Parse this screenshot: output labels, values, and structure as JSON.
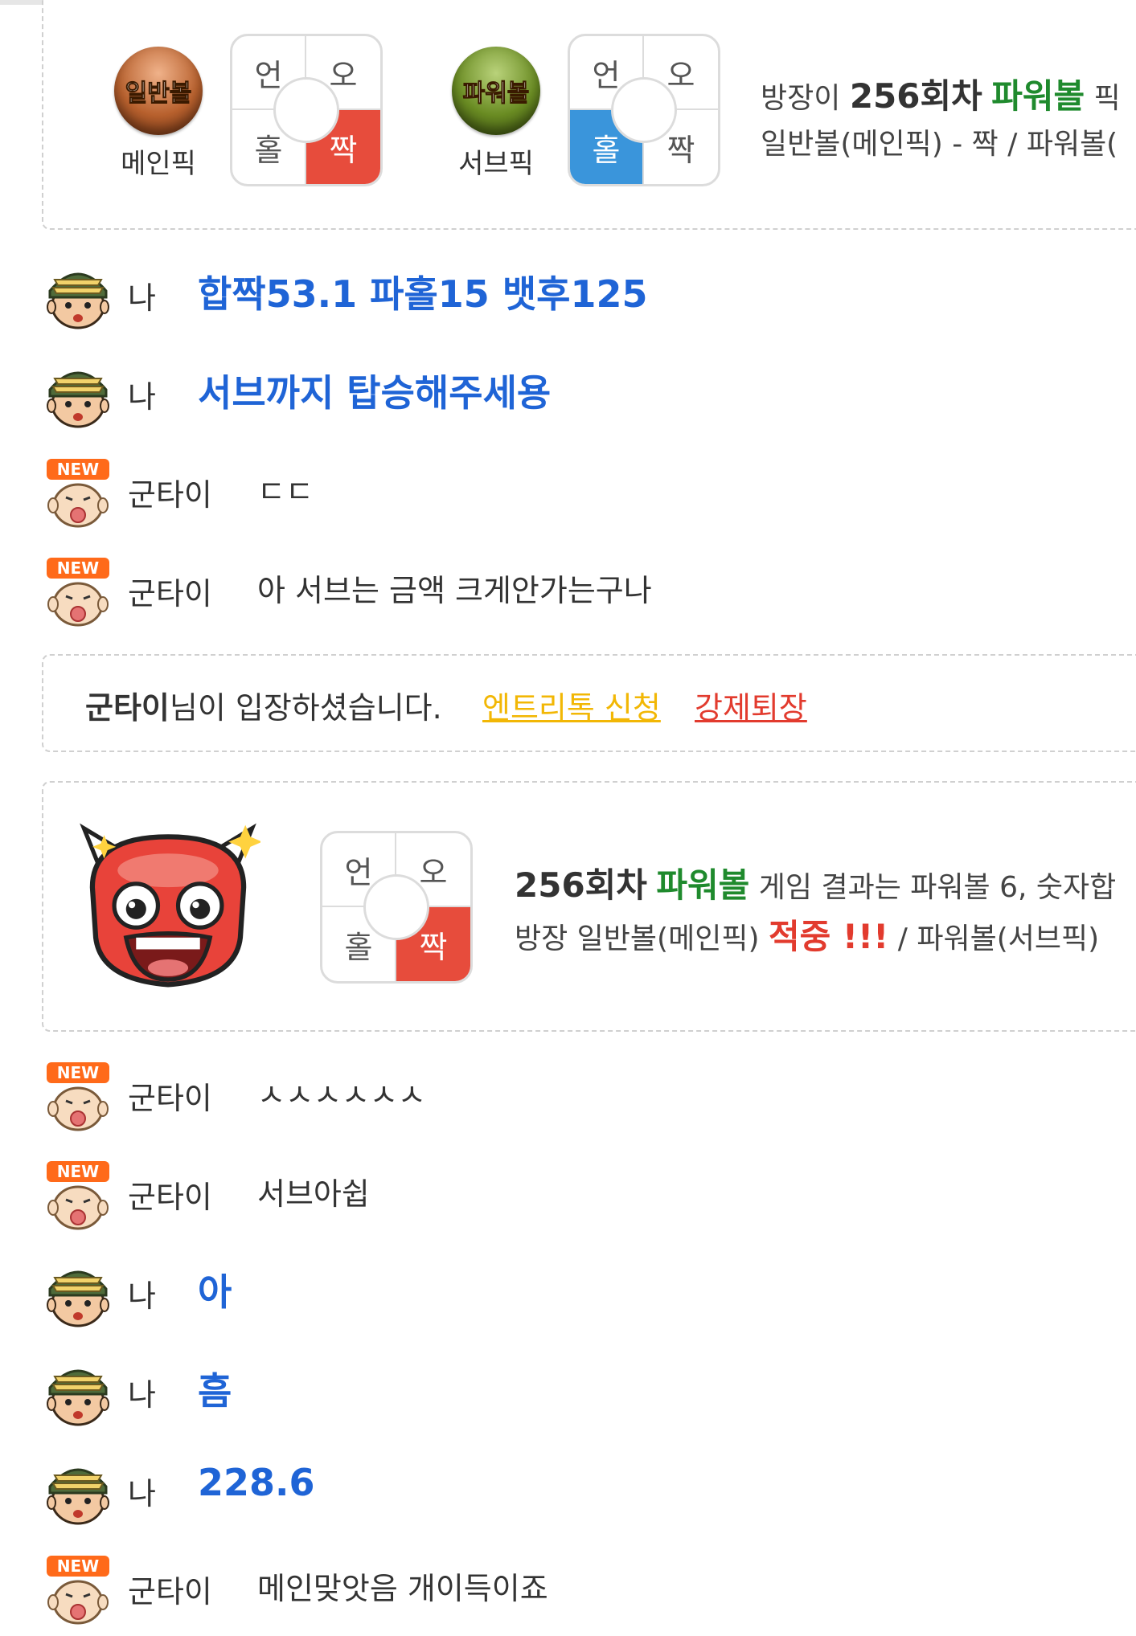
{
  "pick_card": {
    "main_ball_label": "일반볼",
    "main_ball_caption": "메인픽",
    "sub_ball_label": "파워볼",
    "sub_ball_caption": "서브픽",
    "grid_labels": {
      "under": "언",
      "over": "오",
      "odd": "홀",
      "even": "짝"
    },
    "main_selected": "짝",
    "sub_selected": "홀",
    "line1": {
      "prefix": "방장이",
      "round": "256회차",
      "game": "파워볼",
      "suffix": "픽"
    },
    "line2": "일반볼(메인픽) - 짝 / 파워볼("
  },
  "chat": [
    {
      "user": "나",
      "text": "합짝53.1 파홀15 뱃후125",
      "mine": true
    },
    {
      "user": "나",
      "text": "서브까지 탑승해주세용",
      "mine": true
    },
    {
      "user": "군타이",
      "text": "ㄷㄷ",
      "mine": false
    },
    {
      "user": "군타이",
      "text": "아 서브는 금액 크게안가는구나",
      "mine": false
    }
  ],
  "notice": {
    "user": "군타이",
    "text": "님이 입장하셨습니다.",
    "link_entry": "엔트리톡 신청",
    "link_kick": "강제퇴장"
  },
  "result_card": {
    "grid_selected": "짝",
    "line1": {
      "round": "256회차",
      "game": "파워볼",
      "suffix": "게임 결과는 파워볼 6, 숫자합"
    },
    "line2": {
      "prefix": "방장 일반볼(메인픽)",
      "hit": "적중 !!!",
      "suffix": "/ 파워볼(서브픽)"
    }
  },
  "chat2": [
    {
      "user": "군타이",
      "text": "ㅅㅅㅅㅅㅅㅅ",
      "mine": false
    },
    {
      "user": "군타이",
      "text": "서브아쉽",
      "mine": false
    },
    {
      "user": "나",
      "text": "아",
      "mine": true
    },
    {
      "user": "나",
      "text": "흠",
      "mine": true
    },
    {
      "user": "나",
      "text": "228.6",
      "mine": true
    },
    {
      "user": "군타이",
      "text": "메인맞앗음 개이득이죠",
      "mine": false
    }
  ],
  "avatars": {
    "me": "soldier-avatar-icon",
    "other": "new-user-avatar-icon",
    "badge": "NEW"
  },
  "colors": {
    "mine_text": "#1f64d6",
    "green": "#1f8a2d",
    "red": "#e23b2e",
    "blue_cell": "#3a95db",
    "red_cell": "#e74c3c"
  }
}
